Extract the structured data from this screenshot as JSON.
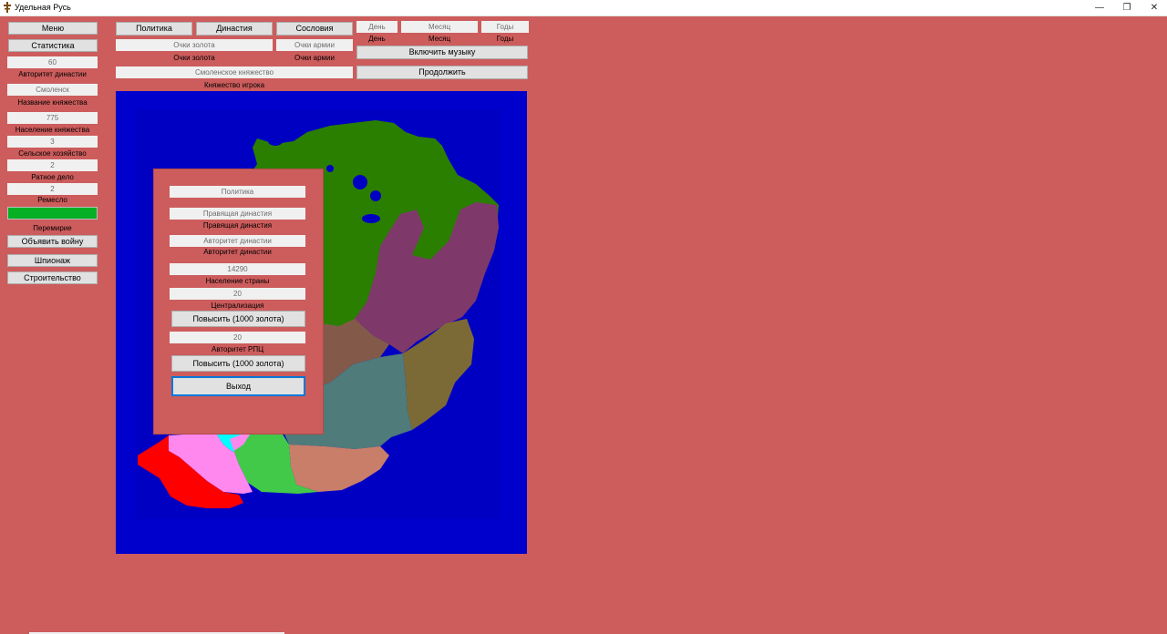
{
  "window": {
    "title": "Удельная Русь",
    "minimize_glyph": "—",
    "restore_glyph": "❐",
    "close_glyph": "✕"
  },
  "sidebar": {
    "menu_label": "Меню",
    "stats_label": "Статистика",
    "dynasty_authority_value": "60",
    "dynasty_authority_label": "Авторитет династии",
    "principality_name_value": "Смоленск",
    "principality_name_label": "Название княжества",
    "population_value": "775",
    "population_label": "Население княжества",
    "agriculture_value": "3",
    "agriculture_label": "Сельское хозяйство",
    "military_value": "2",
    "military_label": "Ратное дело",
    "craft_value": "2",
    "craft_label": "Ремесло",
    "craft_progress": 1.0,
    "truce_label": "Перемирие",
    "declare_war_label": "Объявить войну",
    "espionage_label": "Шпионаж",
    "construction_label": "Строительство"
  },
  "topbar": {
    "politics_label": "Политика",
    "dynasty_label": "Династия",
    "estates_label": "Сословия",
    "gold_value": "Очки золота",
    "gold_label": "Очки золота",
    "army_value": "Очки армии",
    "army_label": "Очки армии",
    "player_principality_value": "Смоленское княжество",
    "player_principality_label": "Княжество игрока",
    "day_value": "День",
    "day_label": "День",
    "month_value": "Месяц",
    "month_label": "Месяц",
    "years_value": "Годы",
    "years_label": "Годы",
    "music_button": "Включить музыку",
    "continue_button": "Продолжить"
  },
  "dialog": {
    "title_value": "Политика",
    "ruling_dynasty_value": "Правящая династия",
    "ruling_dynasty_label": "Правящая династия",
    "dynasty_authority_value": "Авторитет династии",
    "dynasty_authority_label": "Авторитет династии",
    "country_population_value": "14290",
    "country_population_label": "Население страны",
    "centralization_value": "20",
    "centralization_label": "Централизация",
    "raise_centralization_button": "Повысить (1000 золота)",
    "rpc_authority_value": "20",
    "rpc_authority_label": "Авторитет РПЦ",
    "raise_rpc_button": "Повысить (1000 золота)",
    "exit_button": "Выход"
  },
  "colors": {
    "background": "#cd5c5c",
    "sea": "#0000cd",
    "progress": "#06b025",
    "accent_focus": "#0078d7"
  },
  "map": {
    "regions": [
      {
        "name": "north",
        "color": "#2a7f00"
      },
      {
        "name": "north-east",
        "color": "#7e396a"
      },
      {
        "name": "east",
        "color": "#7c6a36"
      },
      {
        "name": "center-brown",
        "color": "#835a4a"
      },
      {
        "name": "center-teal",
        "color": "#4f7b7a"
      },
      {
        "name": "south-salmon",
        "color": "#c97e6a"
      },
      {
        "name": "south-green",
        "color": "#43c94a"
      },
      {
        "name": "south-cyan",
        "color": "#00ffff"
      },
      {
        "name": "south-pink",
        "color": "#ff88ee"
      },
      {
        "name": "south-west-red",
        "color": "#ff0000"
      }
    ]
  }
}
